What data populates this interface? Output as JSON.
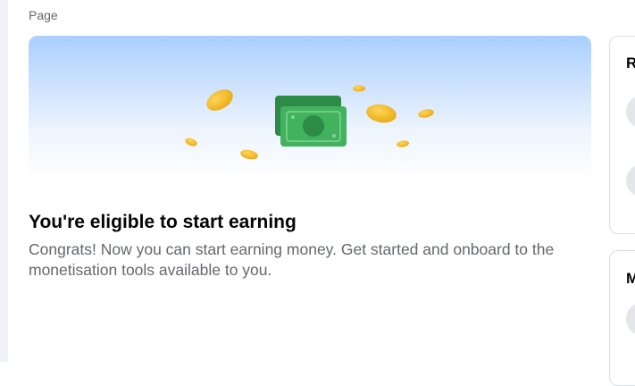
{
  "breadcrumb": {
    "label": "Page"
  },
  "hero": {
    "colors": {
      "sky": "#a9cfff",
      "bill": "#3fae5a",
      "bill_dark": "#2e8b47",
      "coin": "#f2b825"
    }
  },
  "main": {
    "title": "You're eligible to start earning",
    "description": "Congrats! Now you can start earning money. Get started and onboard to the monetisation tools available to you."
  },
  "side_cards": [
    {
      "initial": "R"
    },
    {
      "initial": "M"
    }
  ]
}
